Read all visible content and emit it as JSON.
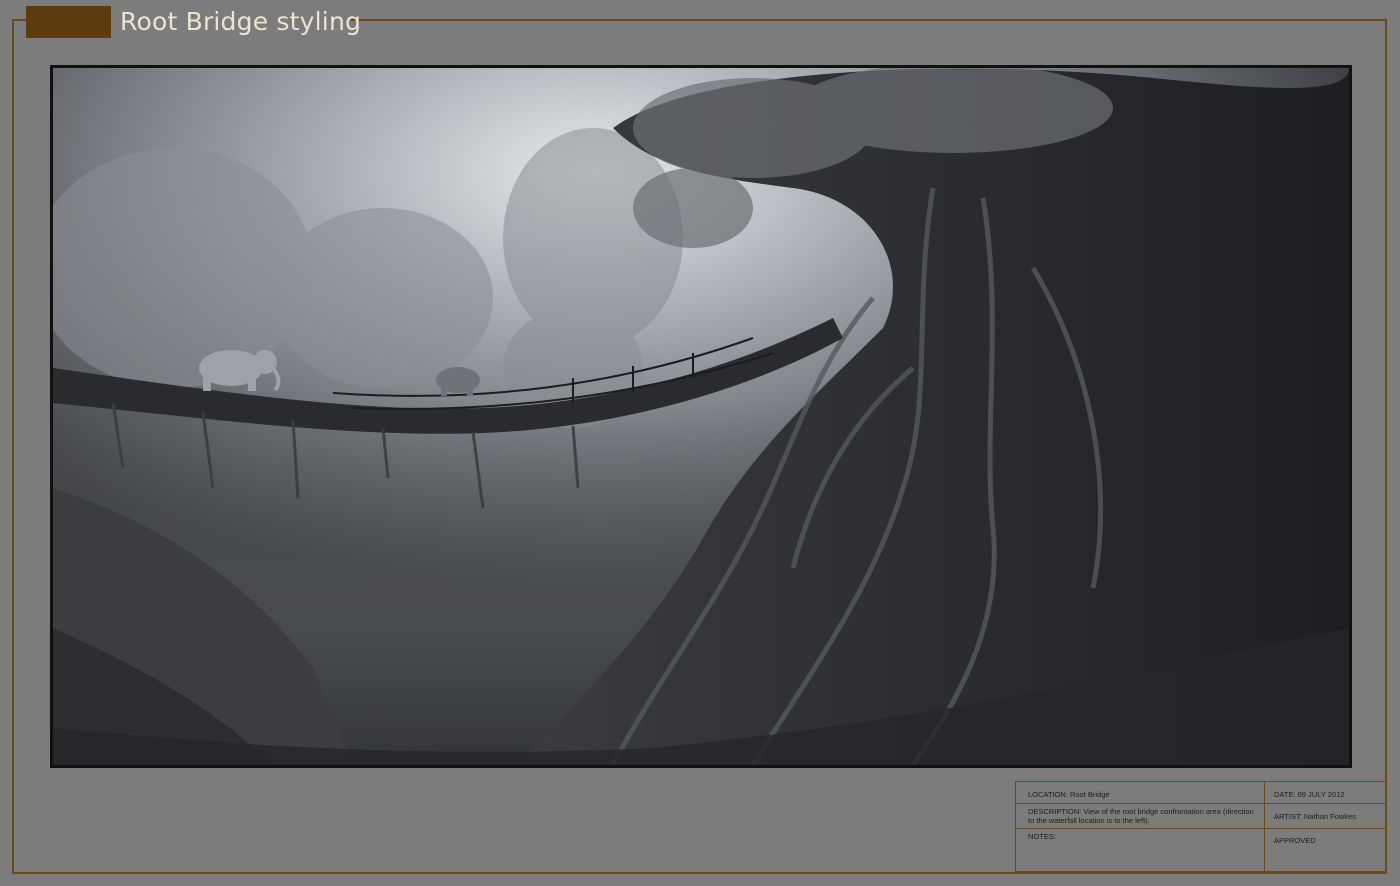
{
  "sheet": {
    "title": "Root Bridge styling",
    "accent_color": "#6b4a22",
    "title_block_color": "#5e3a10"
  },
  "artwork": {
    "palette": [
      "#2b2c2e",
      "#4a4c50",
      "#8c9096",
      "#c9ccd0"
    ]
  },
  "info_panel": {
    "location": "LOCATION: Root Bridge",
    "description": "DESCRIPTION: View of the root bridge confrontation area (direction to the waterfall location is to the left).",
    "notes": "NOTES:",
    "date": "DATE: 09 JULY 2012",
    "artist": "ARTIST: Nathan Fowkes",
    "approved": "APPROVED"
  }
}
